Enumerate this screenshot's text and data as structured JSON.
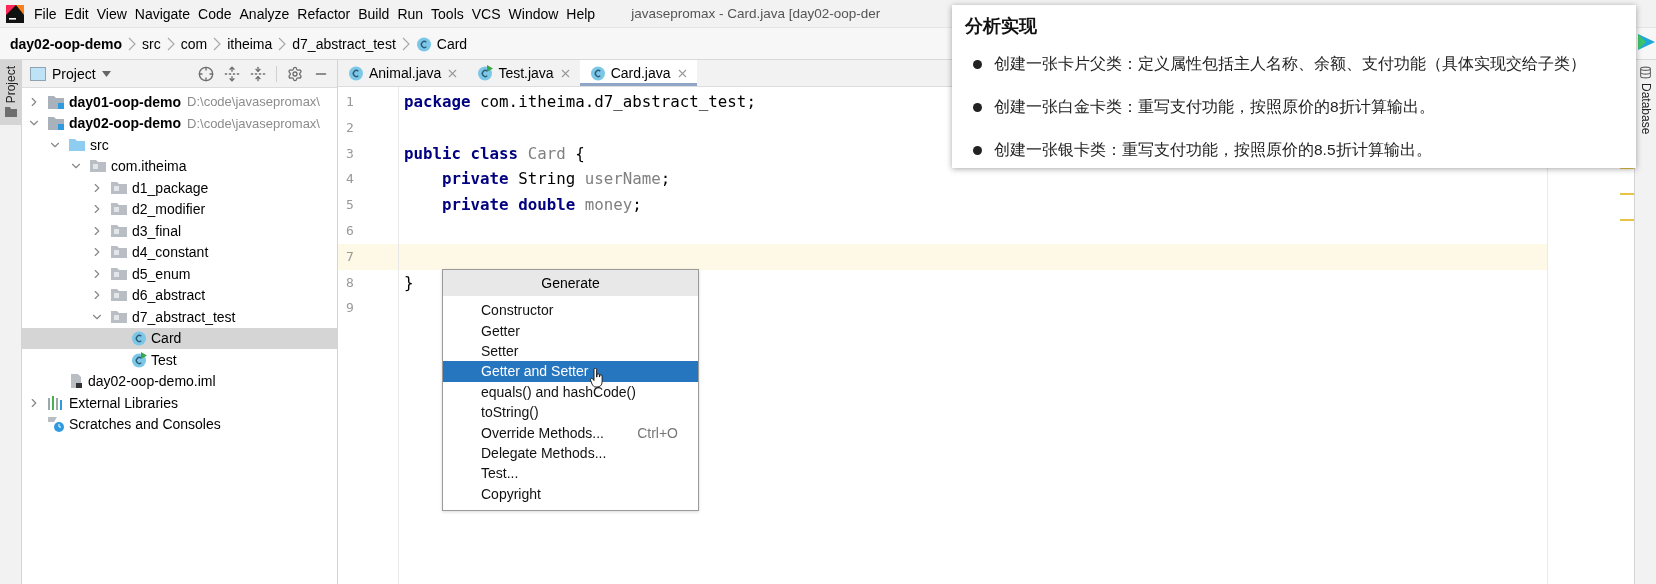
{
  "menu_bar": {
    "items": [
      "File",
      "Edit",
      "View",
      "Navigate",
      "Code",
      "Analyze",
      "Refactor",
      "Build",
      "Run",
      "Tools",
      "VCS",
      "Window",
      "Help"
    ],
    "window_title": "javasepromax - Card.java [day02-oop-der"
  },
  "breadcrumbs": [
    {
      "label": "day02-oop-demo",
      "kind": "module"
    },
    {
      "label": "src",
      "kind": "folder"
    },
    {
      "label": "com",
      "kind": "folder"
    },
    {
      "label": "itheima",
      "kind": "folder"
    },
    {
      "label": "d7_abstract_test",
      "kind": "folder"
    },
    {
      "label": "Card",
      "kind": "class"
    }
  ],
  "left_strip": {
    "label": "Project",
    "selected": true
  },
  "project_panel": {
    "title": "Project",
    "tree": [
      {
        "label": "day01-oop-demo",
        "path": "D:\\code\\javasepromax\\",
        "kind": "module",
        "expanded": false,
        "selected": false
      },
      {
        "label": "day02-oop-demo",
        "path": "D:\\code\\javasepromax\\",
        "kind": "module",
        "expanded": true,
        "selected": false,
        "children": [
          {
            "label": "src",
            "kind": "source-folder",
            "expanded": true,
            "selected": false,
            "children": [
              {
                "label": "com.itheima",
                "kind": "package",
                "expanded": true,
                "selected": false,
                "children": [
                  {
                    "label": "d1_package",
                    "kind": "package",
                    "expanded": false,
                    "selected": false
                  },
                  {
                    "label": "d2_modifier",
                    "kind": "package",
                    "expanded": false,
                    "selected": false
                  },
                  {
                    "label": "d3_final",
                    "kind": "package",
                    "expanded": false,
                    "selected": false
                  },
                  {
                    "label": "d4_constant",
                    "kind": "package",
                    "expanded": false,
                    "selected": false
                  },
                  {
                    "label": "d5_enum",
                    "kind": "package",
                    "expanded": false,
                    "selected": false
                  },
                  {
                    "label": "d6_abstract",
                    "kind": "package",
                    "expanded": false,
                    "selected": false
                  },
                  {
                    "label": "d7_abstract_test",
                    "kind": "package",
                    "expanded": true,
                    "selected": false,
                    "children": [
                      {
                        "label": "Card",
                        "kind": "class",
                        "selected": true
                      },
                      {
                        "label": "Test",
                        "kind": "test-class",
                        "selected": false
                      }
                    ]
                  }
                ]
              }
            ]
          },
          {
            "label": "day02-oop-demo.iml",
            "kind": "iml-file",
            "selected": false
          }
        ]
      },
      {
        "label": "External Libraries",
        "kind": "libraries",
        "expanded": false,
        "selected": false
      },
      {
        "label": "Scratches and Consoles",
        "kind": "scratches",
        "selected": false
      }
    ]
  },
  "tabs": [
    {
      "label": "Animal.java",
      "kind": "class",
      "selected": false
    },
    {
      "label": "Test.java",
      "kind": "test-class",
      "selected": false
    },
    {
      "label": "Card.java",
      "kind": "class",
      "selected": true
    }
  ],
  "editor": {
    "lines": [
      {
        "number": "1",
        "current": false,
        "tokens": [
          {
            "text": "package",
            "kind": "keyword"
          },
          {
            "text": " com.itheima.d7_abstract_test;",
            "kind": "plain"
          }
        ]
      },
      {
        "number": "2",
        "current": false
      },
      {
        "number": "3",
        "current": false,
        "tokens": [
          {
            "text": "public class",
            "kind": "keyword"
          },
          {
            "text": " Card",
            "kind": "unused"
          },
          {
            "text": " {",
            "kind": "plain"
          }
        ]
      },
      {
        "number": "4",
        "current": false,
        "tokens": [
          {
            "text": "    private",
            "kind": "keyword"
          },
          {
            "text": " String ",
            "kind": "plain"
          },
          {
            "text": "userName",
            "kind": "unused"
          },
          {
            "text": ";",
            "kind": "plain"
          }
        ]
      },
      {
        "number": "5",
        "current": false,
        "tokens": [
          {
            "text": "    private double",
            "kind": "keyword"
          },
          {
            "text": " money",
            "kind": "unused"
          },
          {
            "text": ";",
            "kind": "plain"
          }
        ]
      },
      {
        "number": "6",
        "current": false
      },
      {
        "number": "7",
        "current": true
      },
      {
        "number": "8",
        "current": false,
        "tokens": [
          {
            "text": "}",
            "kind": "plain"
          }
        ]
      },
      {
        "number": "9",
        "current": false
      }
    ]
  },
  "generate_popup": {
    "title": "Generate",
    "items": [
      {
        "label": "Constructor",
        "selected": false
      },
      {
        "label": "Getter",
        "selected": false
      },
      {
        "label": "Setter",
        "selected": false
      },
      {
        "label": "Getter and Setter",
        "selected": true
      },
      {
        "label": "equals() and hashCode()",
        "selected": false
      },
      {
        "label": "toString()",
        "selected": false
      },
      {
        "label": "Override Methods...",
        "shortcut": "Ctrl+O",
        "selected": false
      },
      {
        "label": "Delegate Methods...",
        "selected": false
      },
      {
        "label": "Test...",
        "selected": false
      },
      {
        "label": "Copyright",
        "selected": false
      }
    ]
  },
  "right_strip": {
    "label": "Database"
  },
  "overlay": {
    "title": "分析实现",
    "bullets": [
      "创建一张卡片父类：定义属性包括主人名称、余额、支付功能（具体实现交给子类）",
      "创建一张白金卡类：重写支付功能，按照原价的8折计算输出。",
      "创建一张银卡类：重写支付功能，按照原价的8.5折计算输出。"
    ]
  }
}
